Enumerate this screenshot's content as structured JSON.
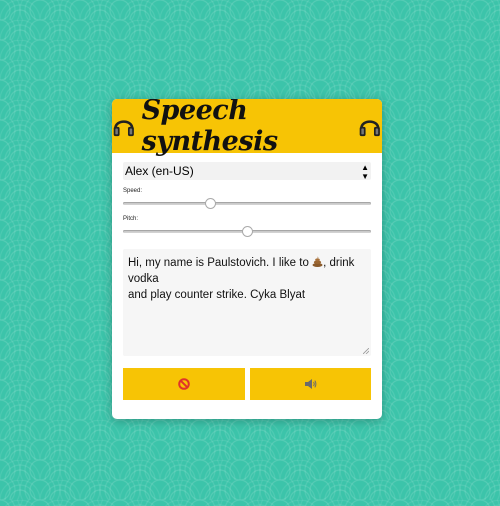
{
  "header": {
    "title": "Speech synthesis",
    "left_icon": "headphones-icon",
    "right_icon": "headphones-icon"
  },
  "voice": {
    "selected": "Alex (en-US)"
  },
  "speed": {
    "label": "Speed:",
    "value": 0.35
  },
  "pitch": {
    "label": "Pitch:",
    "value": 0.5
  },
  "text": {
    "line1": "Hi, my name is Paulstovich. I like to",
    "emoji": "poop-emoji",
    "line1_end": ", drink vodka",
    "line2": "and play counter strike. Cyka Blyat"
  },
  "buttons": {
    "stop_icon": "prohibited-icon",
    "speak_icon": "speaker-icon"
  },
  "colors": {
    "accent": "#f7c405",
    "background": "#3cc4aa"
  }
}
